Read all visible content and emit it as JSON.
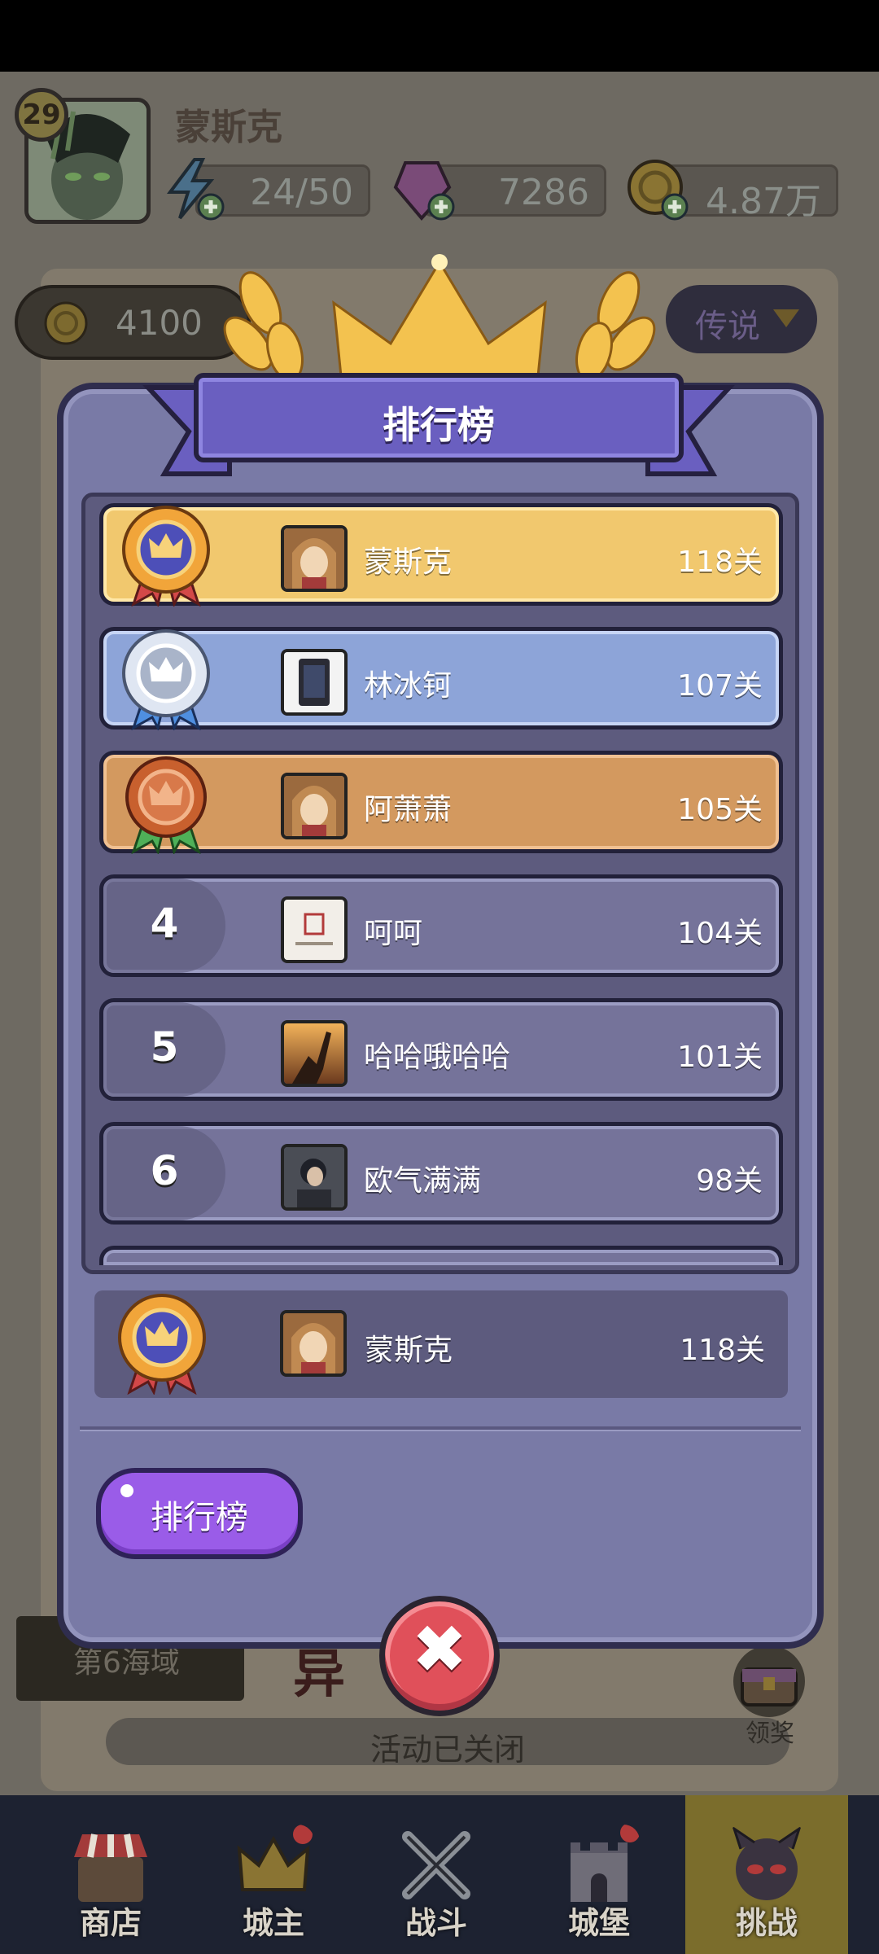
{
  "player": {
    "level": "29",
    "name": "蒙斯克",
    "energy": "24/50",
    "gems": "7286",
    "coins": "4.87万"
  },
  "background": {
    "coins_value": "4100",
    "difficulty": "传说",
    "sea_label": "第6海域",
    "event_title": "异",
    "event_status": "活动已关闭",
    "reward_label": "领奖"
  },
  "modal": {
    "title": "排行榜",
    "rows": [
      {
        "rank": "1",
        "name": "蒙斯克",
        "score": "118关"
      },
      {
        "rank": "2",
        "name": "林冰钶",
        "score": "107关"
      },
      {
        "rank": "3",
        "name": "阿萧萧",
        "score": "105关"
      },
      {
        "rank": "4",
        "name": "呵呵",
        "score": "104关"
      },
      {
        "rank": "5",
        "name": "哈哈哦哈哈",
        "score": "101关"
      },
      {
        "rank": "6",
        "name": "欧气满满",
        "score": "98关"
      }
    ],
    "self_row": {
      "name": "蒙斯克",
      "score": "118关"
    },
    "button_label": "排行榜",
    "close_symbol": "✖"
  },
  "nav": {
    "items": [
      {
        "label": "商店",
        "icon": "shop-icon"
      },
      {
        "label": "城主",
        "icon": "crown-icon"
      },
      {
        "label": "战斗",
        "icon": "swords-icon"
      },
      {
        "label": "城堡",
        "icon": "castle-icon"
      },
      {
        "label": "挑战",
        "icon": "demon-icon"
      }
    ],
    "active": "挑战"
  },
  "colors": {
    "gold_row": "#f1c86e",
    "silver_row": "#8da4d8",
    "bronze_row": "#d3995f",
    "modal_bg": "#797aa6",
    "button_purple": "#9a5ce8",
    "close_red": "#e0505a"
  }
}
